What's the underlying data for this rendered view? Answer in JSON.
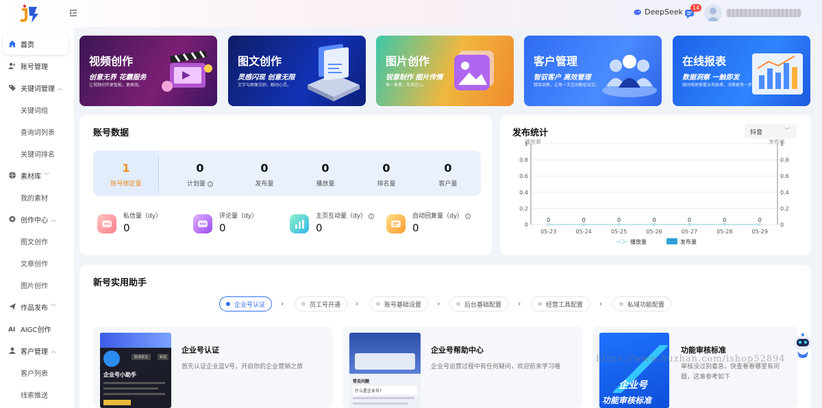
{
  "header": {
    "deepseek_label": "DeepSeek",
    "notify_count": "14"
  },
  "sidebar": {
    "items": [
      {
        "label": "首页",
        "icon": "home-icon",
        "active": true
      },
      {
        "label": "账号管理",
        "icon": "users-icon"
      },
      {
        "label": "关键词管理",
        "icon": "tag-icon",
        "expanded": true
      },
      {
        "label": "关键词组",
        "sub": true
      },
      {
        "label": "查询词列表",
        "sub": true
      },
      {
        "label": "关键词排名",
        "sub": true
      },
      {
        "label": "素材库",
        "icon": "globe-icon",
        "expanded": false
      },
      {
        "label": "我的素材",
        "sub": true
      },
      {
        "label": "创作中心",
        "icon": "gear-icon",
        "expanded": true
      },
      {
        "label": "图文创作",
        "sub": true
      },
      {
        "label": "文章创作",
        "sub": true
      },
      {
        "label": "图片创作",
        "sub": true
      },
      {
        "label": "作品发布",
        "icon": "send-icon",
        "expanded": false
      },
      {
        "label": "AIGC创作",
        "icon": "ai-icon"
      },
      {
        "label": "客户管理",
        "icon": "customer-icon",
        "expanded": true
      },
      {
        "label": "客户列表",
        "sub": true
      },
      {
        "label": "线索推送",
        "sub": true
      }
    ]
  },
  "banners": [
    {
      "title": "视频创作",
      "slogan": "创意无界 花霸服务",
      "desc": "让视频创作更智能，更高效。"
    },
    {
      "title": "图文创作",
      "slogan": "灵感闪现 创意无限",
      "desc": "文字与图像交织，触动心灵。"
    },
    {
      "title": "图片创作",
      "slogan": "锐意制作 图片传情",
      "desc": "每一像素，尽显匠心。"
    },
    {
      "title": "客户管理",
      "slogan": "智驭客户 高效管理",
      "desc": "精准洞察，让每一次互动都促成交。"
    },
    {
      "title": "在线报表",
      "slogan": "数据洞察 一触即发",
      "desc": "随时随地掌握业务脉搏，决策更快一步"
    }
  ],
  "account": {
    "title": "账号数据",
    "stats": [
      {
        "value": "1",
        "label": "账号绑定量"
      },
      {
        "value": "0",
        "label": "计划量"
      },
      {
        "value": "0",
        "label": "发布量"
      },
      {
        "value": "0",
        "label": "播放量"
      },
      {
        "value": "0",
        "label": "排名量"
      },
      {
        "value": "0",
        "label": "客户量"
      }
    ],
    "minis": [
      {
        "label": "私信量（dy）",
        "value": "0"
      },
      {
        "label": "评论量（dy）",
        "value": "0"
      },
      {
        "label": "主页互动量（dy）",
        "value": "0"
      },
      {
        "label": "自动回复量（dy）",
        "value": "0"
      }
    ]
  },
  "publish": {
    "title": "发布统计",
    "platform": "抖音",
    "left_axis": "播放量",
    "right_axis": "发布量"
  },
  "chart_data": {
    "type": "bar",
    "title": "发布统计",
    "categories": [
      "05-23",
      "05-24",
      "05-25",
      "05-26",
      "05-27",
      "05-28",
      "05-29"
    ],
    "series": [
      {
        "name": "播放量",
        "type": "line",
        "values": [
          0,
          0,
          0,
          0,
          0,
          0,
          0
        ]
      },
      {
        "name": "发布量",
        "type": "bar",
        "values": [
          0,
          0,
          0,
          0,
          0,
          0,
          0
        ]
      }
    ],
    "ylabel": "播放量",
    "y2label": "发布量",
    "ylim": [
      0,
      1
    ],
    "y2lim": [
      0,
      1
    ],
    "yticks": [
      "0",
      "0.2",
      "0.4",
      "0.6",
      "0.8",
      "1"
    ],
    "data_labels": [
      "0",
      "0",
      "0",
      "0",
      "0",
      "0",
      "0"
    ],
    "legend_position": "bottom",
    "grid": true,
    "colors": {
      "播放量": "#a9dde6",
      "发布量": "#2f9fd6"
    }
  },
  "helper": {
    "title": "新号实用助手",
    "steps": [
      "企业号认证",
      "员工号开通",
      "账号基础设置",
      "后台基础配置",
      "经营工具配置",
      "私域功能配置"
    ],
    "cards": [
      {
        "title": "企业号认证",
        "desc": "首先认证企业蓝V号，开启你的企业营销之旅"
      },
      {
        "title": "企业号帮助中心",
        "desc": "企业号运营过程中有任何疑问，欢迎前来学习哦"
      },
      {
        "title": "功能审核标准",
        "desc": "审核没过别着急，快查看看哪里有问题，这准参考如下",
        "thumb_text_1": "企业号",
        "thumb_text_2": "功能审核标准"
      }
    ],
    "thumb_labels": {
      "c1_name": "企业号小助手",
      "c1_follow": "取消关注",
      "c1_msg": "私信",
      "c2_q": "常见问题",
      "c2_a": "什么是企业号?"
    }
  },
  "watermark": "https://www.huzhan.com/ishop52894"
}
